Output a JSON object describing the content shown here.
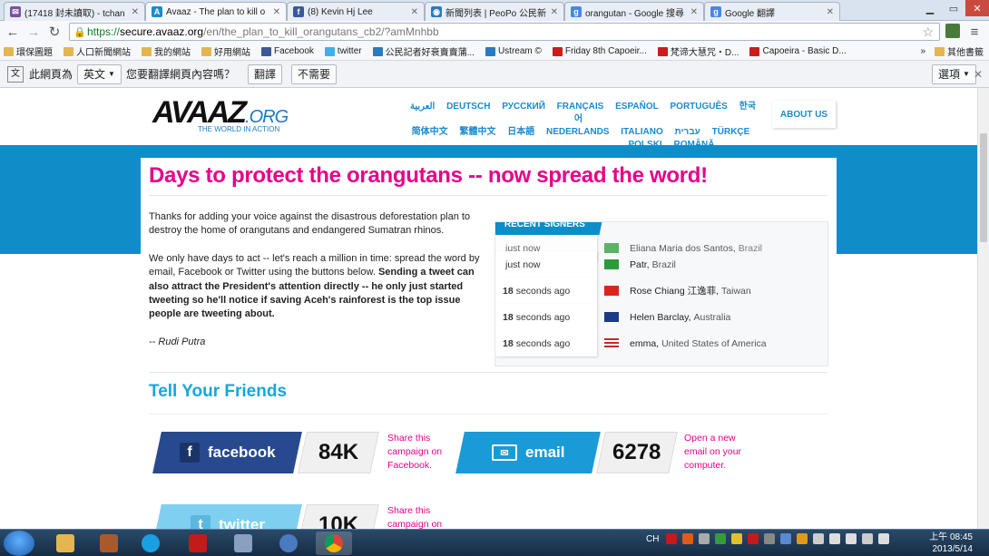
{
  "browser": {
    "tabs": [
      {
        "title": "(17418 封未讀取) - tchan",
        "icon": "mail-icon",
        "color": "#7b4fa0"
      },
      {
        "title": "Avaaz - The plan to kill o",
        "icon": "avaaz-icon",
        "color": "#1a8bd0"
      },
      {
        "title": "(8) Kevin Hj Lee",
        "icon": "facebook-icon",
        "color": "#3b5998"
      },
      {
        "title": "新聞列表 | PeoPo 公民新",
        "icon": "peopo-icon",
        "color": "#2a7ac0"
      },
      {
        "title": "orangutan - Google 搜尋",
        "icon": "google-icon",
        "color": "#4a86e8"
      },
      {
        "title": "Google 翻譯",
        "icon": "google-translate-icon",
        "color": "#4a86e8"
      }
    ],
    "url": {
      "scheme": "https://",
      "host": "secure.avaaz.org",
      "path": "/en/the_plan_to_kill_orangutans_cb2/?amMnhbb"
    },
    "bookmarks": [
      "環保圖題",
      "人口新聞網站",
      "我的網站",
      "好用網站",
      "Facebook",
      "twitter",
      "公民記者好衰賣賣蒲...",
      "Ustream ©",
      "Friday 8th Capoeir...",
      "梵谛大慧咒・D...",
      "Capoeira - Basic D..."
    ],
    "bookmarks_more": "»",
    "other_bookmarks": "其他書籤",
    "translate": {
      "prefix": "此網頁為",
      "language": "英文",
      "question": "您要翻譯網頁內容嗎？",
      "translate_btn": "翻譯",
      "no_btn": "不需要",
      "options_btn": "選項"
    }
  },
  "header": {
    "logo_main": "AVAAZ",
    "logo_org": ".ORG",
    "logo_tag": "THE WORLD IN ACTION",
    "languages_row1": [
      "العربية",
      "DEUTSCH",
      "РУССКИЙ",
      "FRANÇAIS",
      "ESPAÑOL",
      "PORTUGUÊS",
      "한국어"
    ],
    "languages_row2": [
      "简体中文",
      "繁體中文",
      "日本語",
      "NEDERLANDS",
      "ITALIANO",
      "עברית",
      "TÜRKÇE"
    ],
    "languages_row3": [
      "POLSKI",
      "ROMÂNĂ"
    ],
    "about_us": "ABOUT US"
  },
  "main": {
    "headline": "Days to protect the orangutans -- now spread the word!",
    "para1": "Thanks for adding your voice against the disastrous deforestation plan to destroy the home of orangutans and endangered Sumatran rhinos.",
    "para2_plain": "We only have days to act -- let's reach a million in time: spread the word by email, Facebook or Twitter using the buttons below.",
    "para2_bold": "Sending a tweet can also attract the President's attention directly -- he only just started tweeting so he'll notice if saving Aceh's rainforest is the top issue people are tweeting about.",
    "signature": "-- Rudi Putra",
    "recent_signers_title": "RECENT SIGNERS",
    "signers": [
      {
        "when_bold": "",
        "when": "just now",
        "name": "Eliana Maria dos Santos,",
        "country": "Brazil",
        "flag": "brazil-flag-icon"
      },
      {
        "when_bold": "",
        "when": "just now",
        "name": "Patr,",
        "country": "Brazil",
        "flag": "brazil-flag-icon"
      },
      {
        "when_bold": "18",
        "when": "seconds ago",
        "name": "Rose Chiang 江逸菲,",
        "country": "Taiwan",
        "flag": "taiwan-flag-icon"
      },
      {
        "when_bold": "18",
        "when": "seconds ago",
        "name": "Helen Barclay,",
        "country": "Australia",
        "flag": "australia-flag-icon"
      },
      {
        "when_bold": "18",
        "when": "seconds ago",
        "name": "emma,",
        "country": "United States of America",
        "flag": "usa-flag-icon"
      }
    ],
    "tell_friends": "Tell Your Friends",
    "share": {
      "facebook_label": "facebook",
      "facebook_count": "84K",
      "facebook_desc": "Share this campaign on Facebook.",
      "email_label": "email",
      "email_count": "6278",
      "email_desc": "Open a new email on your computer.",
      "twitter_label": "twitter",
      "twitter_count": "10K",
      "twitter_desc": "Share this campaign on"
    }
  },
  "taskbar": {
    "tray_lang": "CH",
    "time": "上午 08:45",
    "date": "2013/5/14"
  },
  "colors": {
    "avaaz_blue": "#0f8dc8",
    "headline_pink": "#e5008a",
    "facebook_blue": "#274a8e",
    "email_blue": "#1a9ad6",
    "twitter_blue": "#7fd0f0"
  }
}
